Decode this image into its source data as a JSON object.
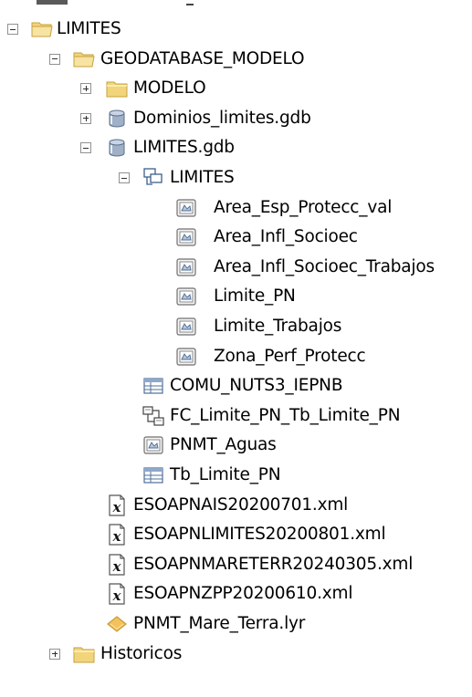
{
  "tree": {
    "items": [
      {
        "label": "LIMITES",
        "icon": "folder-open-icon",
        "expander": "minus",
        "level": 0
      },
      {
        "label": "GEODATABASE_MODELO",
        "icon": "folder-open-icon",
        "expander": "minus",
        "level": 1
      },
      {
        "label": "MODELO",
        "icon": "folder-icon",
        "expander": "plus",
        "level": 2
      },
      {
        "label": "Dominios_limites.gdb",
        "icon": "geodatabase-icon",
        "expander": "plus",
        "level": 2
      },
      {
        "label": "LIMITES.gdb",
        "icon": "geodatabase-icon",
        "expander": "minus",
        "level": 2
      },
      {
        "label": "LIMITES",
        "icon": "feature-dataset-icon",
        "expander": "minus",
        "level": 3
      },
      {
        "label": "Area_Esp_Protecc_val",
        "icon": "polygon-feature-class-icon",
        "expander": "none",
        "level": 4
      },
      {
        "label": "Area_Infl_Socioec",
        "icon": "polygon-feature-class-icon",
        "expander": "none",
        "level": 4
      },
      {
        "label": "Area_Infl_Socioec_Trabajos",
        "icon": "polygon-feature-class-icon",
        "expander": "none",
        "level": 4
      },
      {
        "label": "Limite_PN",
        "icon": "polygon-feature-class-icon",
        "expander": "none",
        "level": 4
      },
      {
        "label": "Limite_Trabajos",
        "icon": "polygon-feature-class-icon",
        "expander": "none",
        "level": 4
      },
      {
        "label": "Zona_Perf_Protecc",
        "icon": "polygon-feature-class-icon",
        "expander": "none",
        "level": 4
      },
      {
        "label": "COMU_NUTS3_IEPNB",
        "icon": "table-icon",
        "expander": "none",
        "level": 3
      },
      {
        "label": "FC_Limite_PN_Tb_Limite_PN",
        "icon": "relationship-class-icon",
        "expander": "none",
        "level": 3
      },
      {
        "label": "PNMT_Aguas",
        "icon": "polygon-feature-class-icon",
        "expander": "none",
        "level": 3
      },
      {
        "label": "Tb_Limite_PN",
        "icon": "table-icon",
        "expander": "none",
        "level": 3
      },
      {
        "label": "ESOAPNAIS20200701.xml",
        "icon": "xml-file-icon",
        "expander": "none",
        "level": 2
      },
      {
        "label": "ESOAPNLIMITES20200801.xml",
        "icon": "xml-file-icon",
        "expander": "none",
        "level": 2
      },
      {
        "label": "ESOAPNMARETERR20240305.xml",
        "icon": "xml-file-icon",
        "expander": "none",
        "level": 2
      },
      {
        "label": "ESOAPNZPP20200610.xml",
        "icon": "xml-file-icon",
        "expander": "none",
        "level": 2
      },
      {
        "label": "PNMT_Mare_Terra.lyr",
        "icon": "layer-file-icon",
        "expander": "none",
        "level": 2
      },
      {
        "label": "Historicos",
        "icon": "folder-icon",
        "expander": "plus",
        "level": 1
      }
    ]
  },
  "colors": {
    "folder": "#f2d57a",
    "folder_edge": "#c7a13c",
    "gdb": "#9fb0c7",
    "layer": "#f3c25e"
  }
}
